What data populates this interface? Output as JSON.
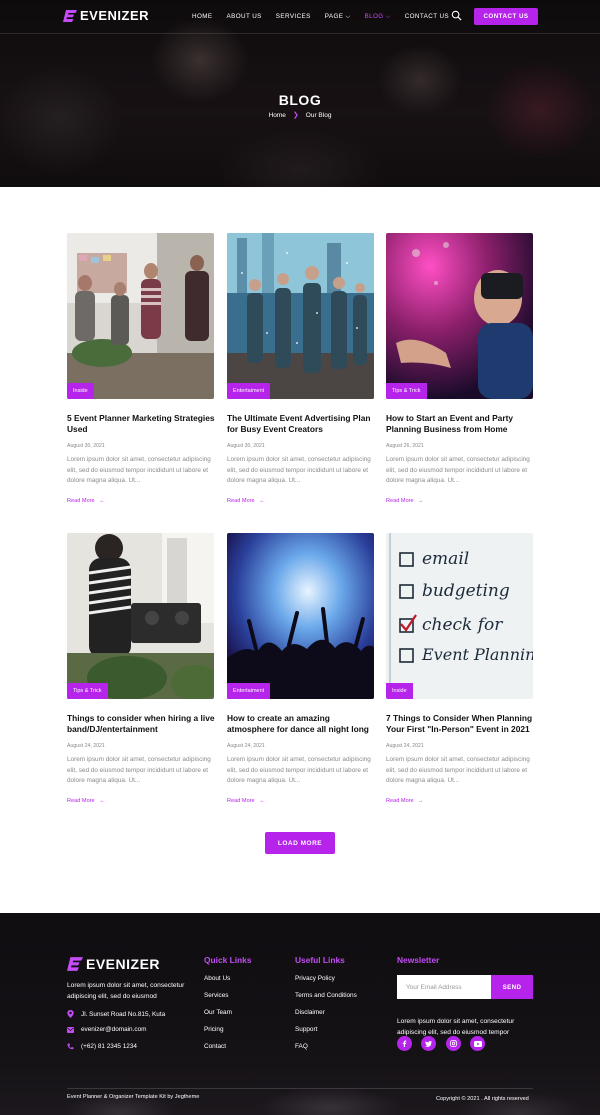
{
  "header": {
    "brand": "EVENIZER",
    "nav": [
      {
        "label": "HOME",
        "active": false,
        "has_dropdown": false
      },
      {
        "label": "ABOUT US",
        "active": false,
        "has_dropdown": false
      },
      {
        "label": "SERVICES",
        "active": false,
        "has_dropdown": false
      },
      {
        "label": "PAGE",
        "active": false,
        "has_dropdown": true
      },
      {
        "label": "BLOG",
        "active": true,
        "has_dropdown": true
      },
      {
        "label": "CONTACT US",
        "active": false,
        "has_dropdown": false
      }
    ],
    "search_icon": "search-icon",
    "contact_button": "CONTACT US"
  },
  "hero": {
    "title": "BLOG",
    "breadcrumb": {
      "home": "Home",
      "separator_icon": "chevron-right-icon",
      "current": "Our Blog"
    }
  },
  "posts": [
    {
      "category": "Inside",
      "title": "5 Event Planner Marketing Strategies Used",
      "date": "August 30, 2021",
      "excerpt": "Lorem ipsum dolor sit amet, consectetur adipiscing elit, sed do eiusmod tempor incididunt ut labore et dolore magna aliqua. Ut...",
      "read_more": "Read More",
      "image_theme": "office party"
    },
    {
      "category": "Entertaiment",
      "title": "The Ultimate Event Advertising Plan for Busy Event Creators",
      "date": "August 30, 2021",
      "excerpt": "Lorem ipsum dolor sit amet, consectetur adipiscing elit, sed do eiusmod tempor incididunt ut labore et dolore magna aliqua. Ut...",
      "read_more": "Read More",
      "image_theme": "confetti party"
    },
    {
      "category": "Tips & Trick",
      "title": "How to Start an Event and Party Planning Business from Home",
      "date": "August 26, 2021",
      "excerpt": "Lorem ipsum dolor sit amet, consectetur adipiscing elit, sed do eiusmod tempor incididunt ut labore et dolore magna aliqua. Ut...",
      "read_more": "Read More",
      "image_theme": "vr headset"
    },
    {
      "category": "Tips & Trick",
      "title": "Things to consider when hiring a live band/DJ/entertainment",
      "date": "August 24, 2021",
      "excerpt": "Lorem ipsum dolor sit amet, consectetur adipiscing elit, sed do eiusmod tempor incididunt ut labore et dolore magna aliqua. Ut...",
      "read_more": "Read More",
      "image_theme": "dj"
    },
    {
      "category": "Entertaiment",
      "title": "How to create an amazing atmosphere for dance all night long",
      "date": "August 24, 2021",
      "excerpt": "Lorem ipsum dolor sit amet, consectetur adipiscing elit, sed do eiusmod tempor incididunt ut labore et dolore magna aliqua. Ut...",
      "read_more": "Read More",
      "image_theme": "concert"
    },
    {
      "category": "Inside",
      "title": "7 Things to Consider When Planning Your First \"In-Person\" Event in 2021",
      "date": "August 24, 2021",
      "excerpt": "Lorem ipsum dolor sit amet, consectetur adipiscing elit, sed do eiusmod tempor incididunt ut labore et dolore magna aliqua. Ut...",
      "read_more": "Read More",
      "image_theme": "checklist",
      "checklist": [
        "email",
        "budgeting",
        "check for",
        "Event Planning"
      ]
    }
  ],
  "load_more": "LOAD MORE",
  "footer": {
    "brand": "EVENIZER",
    "about": "Lorem ipsum dolor sit amet, consectetur adipiscing elit, sed do eiusmod",
    "address": "Jl. Sunset Road No.815, Kuta",
    "email": "evenizer@domain.com",
    "phone": "(+62) 81 2345 1234",
    "quick_links_title": "Quick Links",
    "quick_links": [
      "About Us",
      "Services",
      "Our Team",
      "Pricing",
      "Contact"
    ],
    "useful_links_title": "Useful Links",
    "useful_links": [
      "Privacy Policy",
      "Terms and Conditions",
      "Disclaimer",
      "Support",
      "FAQ"
    ],
    "newsletter_title": "Newsletter",
    "newsletter_placeholder": "Your Email Address",
    "newsletter_button": "SEND",
    "newsletter_text": "Lorem ipsum dolor sit amet, consectetur adipiscing elit, sed do eiusmod tempor",
    "social": [
      "facebook-icon",
      "twitter-icon",
      "instagram-icon",
      "youtube-icon"
    ],
    "bottom_left": "Event Planner & Organizer Template Kit by Jegtheme",
    "bottom_right": "Copyright © 2021 . All rights reserved"
  },
  "colors": {
    "accent": "#b623ea",
    "accent_light": "#c34cf5",
    "footer_bg": "#151216"
  }
}
